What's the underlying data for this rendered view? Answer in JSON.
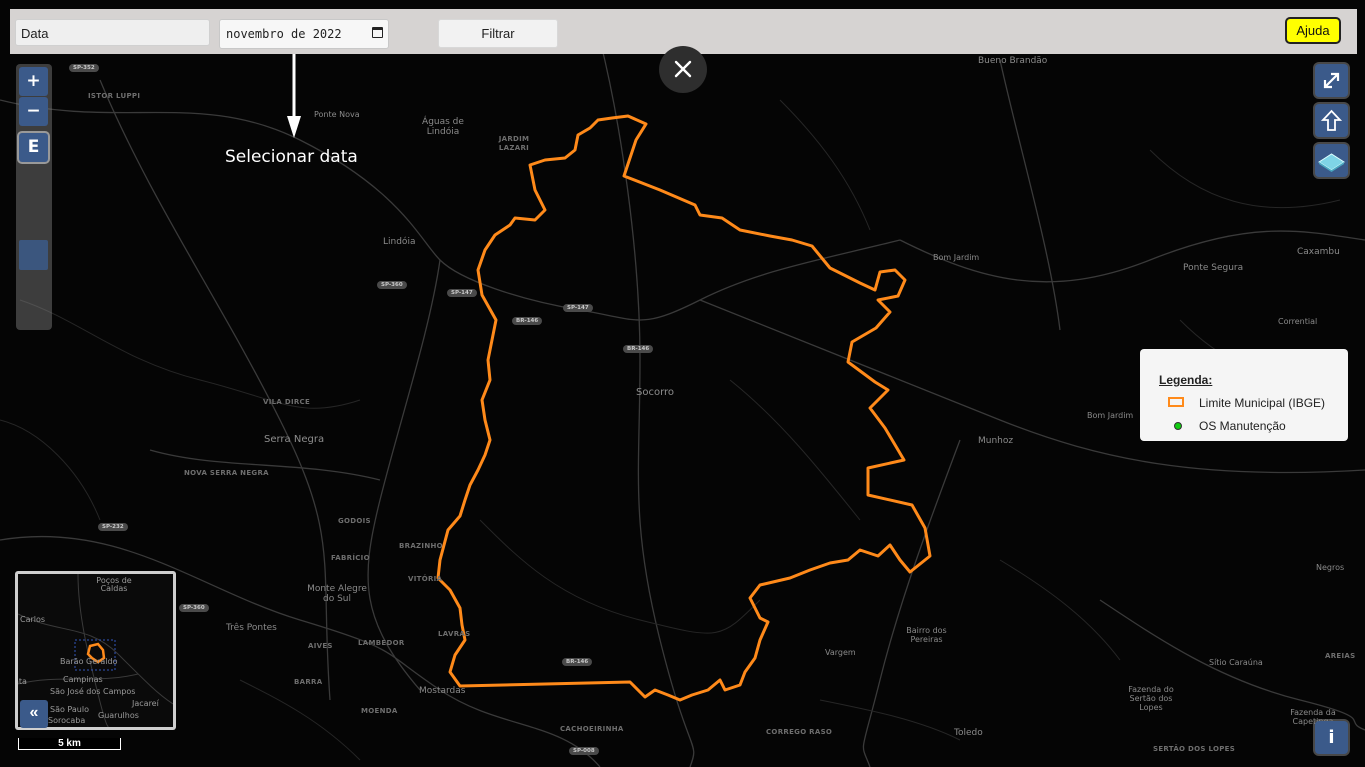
{
  "toolbar": {
    "data_field": "Data",
    "date_value": "novembro de 2022",
    "filter_label": "Filtrar",
    "help_label": "Ajuda"
  },
  "annotation": {
    "text": "Selecionar data"
  },
  "map_controls": {
    "zoom_in": "+",
    "zoom_out": "−",
    "extent": "E",
    "info": "i",
    "overview_toggle": "«",
    "scale": "5 km"
  },
  "legend": {
    "title": "Legenda:",
    "items": [
      {
        "label": "Limite Municipal (IBGE)",
        "symbol": "orange-outline-rect",
        "color": "#ff8a1a"
      },
      {
        "label": "OS Manutenção",
        "symbol": "green-dot",
        "color": "#11cc11"
      }
    ]
  },
  "place_labels": [
    "Bueno Brandão",
    "Águas de Lindóia",
    "JARDIM LAZARI",
    "Ponte Nova",
    "ISTOR LUPPI",
    "Lindóia",
    "Bom Jardim",
    "Caxambu",
    "Ponte Segura",
    "Corrential",
    "Socorro",
    "VILA DIRCE",
    "Serra Negra",
    "NOVA SERRA NEGRA",
    "Bom Jardim",
    "Munhoz",
    "GODOIS",
    "FABRÍCIO",
    "BRAZINHO",
    "VITÓRIA",
    "Monte Alegre do Sul",
    "Três Pontes",
    "AIVES",
    "LAMBEDOR",
    "LAVRAS",
    "BARRA",
    "Mostardas",
    "MOENDA",
    "CACHOEIRINHA",
    "Vargem",
    "Bairro dos Pereiras",
    "CORREGO RASO",
    "Toledo",
    "Sítio Caraúna",
    "AREIAS",
    "Negros",
    "Fazenda do Sertão dos Lopes",
    "Fazenda da Capetinga",
    "SERTÃO DOS LOPES"
  ],
  "road_shields": [
    "SP-352",
    "SP-360",
    "SP-147",
    "BR-146",
    "SP-147",
    "BR-146",
    "SP-232",
    "SP-360",
    "BR-146",
    "SP-008"
  ],
  "overview_labels": [
    "Poços de Caldas",
    "Carlos",
    "Barão Geraldo",
    "Campinas",
    "São José dos Campos",
    "São Paulo",
    "Jacareí",
    "Sorocaba",
    "Guarulhos",
    "ata"
  ],
  "colors": {
    "boundary": "#ff8a1a",
    "control_blue": "#3b5a8a",
    "help_yellow": "#ffff00",
    "topbar": "#d6d3d2"
  }
}
